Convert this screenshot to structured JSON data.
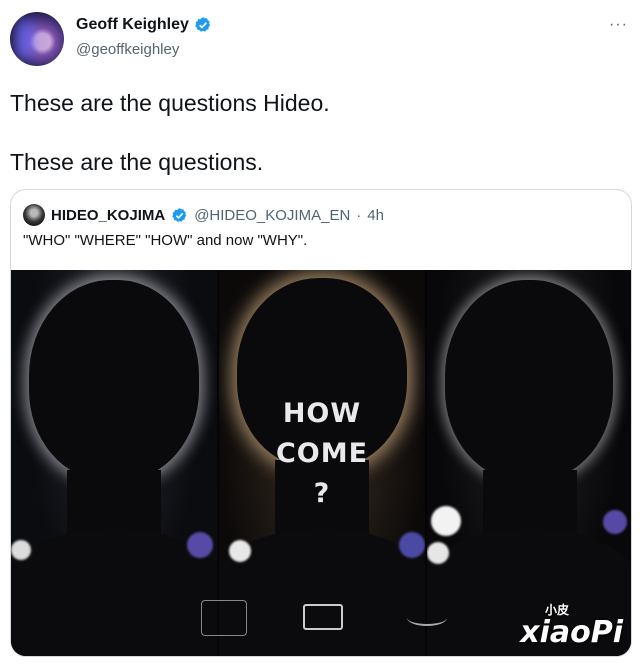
{
  "author": {
    "name": "Geoff Keighley",
    "handle": "@geoffkeighley",
    "verified_icon": "verified-badge-icon",
    "more_label": "···"
  },
  "tweet": {
    "lines": [
      "These are the questions Hideo.",
      "These are the questions."
    ]
  },
  "quoted": {
    "name": "HIDEO_KOJIMA",
    "handle": "@HIDEO_KOJIMA_EN",
    "separator": "·",
    "time": "4h",
    "text": "\"WHO\" \"WHERE\" \"HOW\" and now \"WHY\"."
  },
  "media": {
    "overlay_line1": "HOW",
    "overlay_line2": "COME",
    "overlay_line3": "?",
    "watermark": "xiaoPi",
    "watermark_small": "小皮"
  },
  "colors": {
    "accent": "#1d9bf0",
    "muted": "#536471",
    "border": "#cfd9de"
  }
}
